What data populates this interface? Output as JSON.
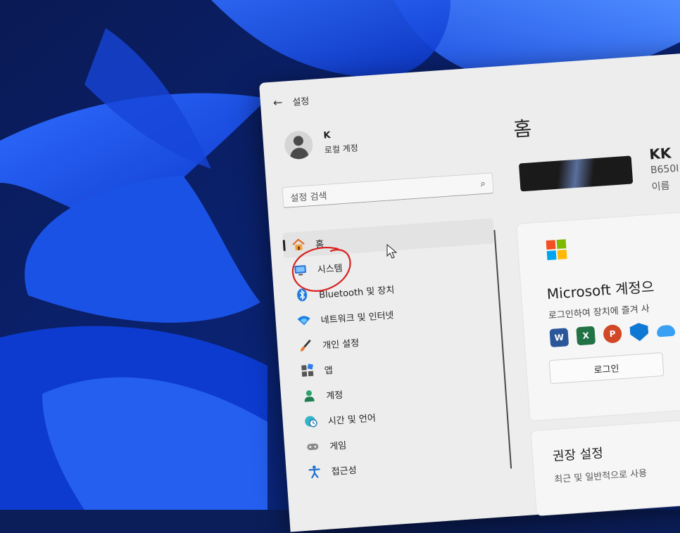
{
  "window": {
    "title": "설정"
  },
  "profile": {
    "name": "K",
    "account_type": "로컬 계정"
  },
  "search": {
    "placeholder": "설정 검색"
  },
  "nav": {
    "items": [
      {
        "label": "홈",
        "icon": "home-icon",
        "active": true
      },
      {
        "label": "시스템",
        "icon": "system-icon",
        "active": false
      },
      {
        "label": "Bluetooth 및 장치",
        "icon": "bluetooth-icon",
        "active": false
      },
      {
        "label": "네트워크 및 인터넷",
        "icon": "wifi-icon",
        "active": false
      },
      {
        "label": "개인 설정",
        "icon": "brush-icon",
        "active": false
      },
      {
        "label": "앱",
        "icon": "apps-icon",
        "active": false
      },
      {
        "label": "계정",
        "icon": "account-icon",
        "active": false
      },
      {
        "label": "시간 및 언어",
        "icon": "clock-globe-icon",
        "active": false
      },
      {
        "label": "게임",
        "icon": "gamepad-icon",
        "active": false
      },
      {
        "label": "접근성",
        "icon": "accessibility-icon",
        "active": false
      }
    ]
  },
  "main": {
    "title": "홈",
    "device": {
      "name": "KK",
      "model": "B650I",
      "rename": "이름"
    },
    "ms_card": {
      "title": "Microsoft 계정으",
      "description": "로그인하여 장치에 즐겨 사",
      "apps": [
        {
          "letter": "W",
          "color": "#2b579a"
        },
        {
          "letter": "X",
          "color": "#217346"
        },
        {
          "letter": "P",
          "color": "#d24726"
        },
        {
          "letter": "",
          "color": "#0f78d4"
        },
        {
          "letter": "",
          "color": "#3aa0f3"
        }
      ],
      "login_label": "로그인"
    },
    "recommended": {
      "title": "권장 설정",
      "description": "최근 및 일반적으로 사용"
    }
  },
  "colors": {
    "annotation": "#d8201e",
    "ms_red": "#f25022",
    "ms_green": "#7fba00",
    "ms_blue": "#00a4ef",
    "ms_yellow": "#ffb900"
  }
}
